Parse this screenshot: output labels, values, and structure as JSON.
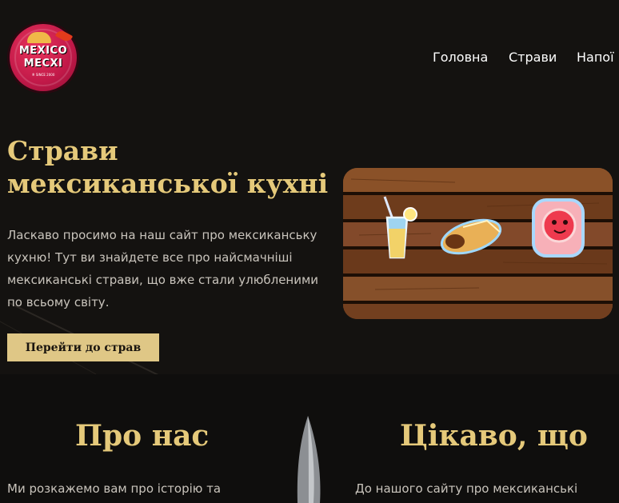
{
  "header": {
    "logo": {
      "line1": "MEXICO",
      "line2": "MECXI",
      "tagline": "® SINCE 2000"
    },
    "nav": [
      {
        "label": "Головна"
      },
      {
        "label": "Страви"
      },
      {
        "label": "Напої"
      }
    ]
  },
  "hero": {
    "title": "Страви мексиканської кухні",
    "description": "Ласкаво просимо на наш сайт про мексиканську кухню! Тут ви знайдете все про найсмачніші мексиканські страви, що вже стали улюбленими по всьому світу.",
    "cta_label": "Перейти до страв"
  },
  "about": {
    "left": {
      "heading": "Про нас",
      "text": "Ми розкажемо вам про історію та"
    },
    "right": {
      "heading": "Цікаво, що",
      "text": "До нашого сайту про мексиканські"
    }
  },
  "colors": {
    "accent": "#dfc786",
    "heading": "#e5c97a",
    "background": "#141210",
    "logo_red": "#c01848"
  },
  "icons": [
    "logo-badge",
    "drink-icon",
    "burrito-icon",
    "grapefruit-drink-icon",
    "knife-icon"
  ]
}
